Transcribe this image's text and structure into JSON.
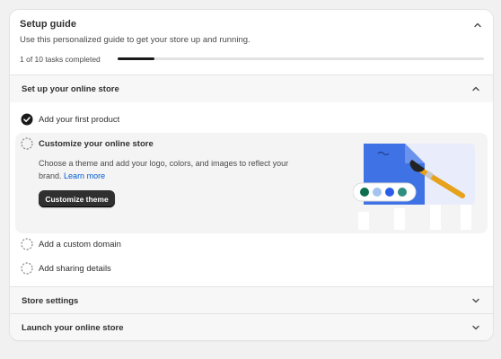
{
  "guide": {
    "title": "Setup guide",
    "subtitle": "Use this personalized guide to get your store up and running.",
    "progress_text": "1 of 10 tasks completed",
    "progress_fraction": 0.1
  },
  "sections": [
    {
      "title": "Set up your online store",
      "expanded": true,
      "tasks": [
        {
          "label": "Add your first product",
          "status": "completed"
        },
        {
          "label": "Customize your online store",
          "status": "pending",
          "expanded": true,
          "description": "Choose a theme and add your logo, colors, and images to reflect your brand.",
          "link_text": "Learn more",
          "button_label": "Customize theme"
        },
        {
          "label": "Add a custom domain",
          "status": "pending"
        },
        {
          "label": "Add sharing details",
          "status": "pending"
        }
      ]
    },
    {
      "title": "Store settings",
      "expanded": false
    },
    {
      "title": "Launch your online store",
      "expanded": false
    }
  ],
  "icons": {
    "collapse": "chevron-up-icon",
    "expand": "chevron-down-icon",
    "completed": "check-circle-icon",
    "pending": "dashed-circle-icon"
  },
  "colors": {
    "accent_link": "#005bd3",
    "button_bg": "#303030",
    "illustration_blue": "#3f72e4",
    "swatches": [
      "#0b6e4f",
      "#a4c3ef",
      "#2a5ee8",
      "#2f8f7f"
    ]
  }
}
